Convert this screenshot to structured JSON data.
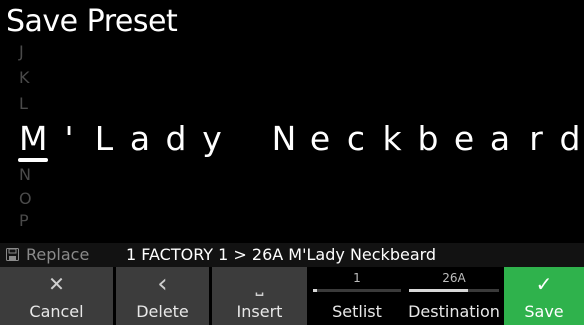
{
  "header": {
    "title": "Save Preset"
  },
  "char_picker": {
    "above": [
      "J",
      "K",
      "L"
    ],
    "below": [
      "N",
      "O",
      "P"
    ]
  },
  "preset_name": [
    "M",
    "'",
    "L",
    "a",
    "d",
    "y",
    " ",
    "N",
    "e",
    "c",
    "k",
    "b",
    "e",
    "a",
    "r",
    "d"
  ],
  "status": {
    "icon": "save-icon",
    "replace_label": "Replace",
    "info": "1 FACTORY 1 > 26A M'Lady Neckbeard"
  },
  "toolbar": {
    "cancel": {
      "icon": "close-icon",
      "glyph": "✕",
      "label": "Cancel"
    },
    "delete": {
      "icon": "chevron-left-icon",
      "glyph": "‹",
      "label": "Delete"
    },
    "insert": {
      "icon": "space-icon",
      "glyph": "⎵",
      "label": "Insert"
    },
    "setlist": {
      "value": "1",
      "label": "Setlist",
      "level": 0.04
    },
    "destination": {
      "value": "26A",
      "label": "Destination",
      "level": 0.66
    },
    "save": {
      "icon": "check-icon",
      "glyph": "✓",
      "label": "Save"
    }
  },
  "colors": {
    "accent_save": "#2fb24c",
    "button": "#3c3c3c",
    "status_bar": "#121212"
  }
}
